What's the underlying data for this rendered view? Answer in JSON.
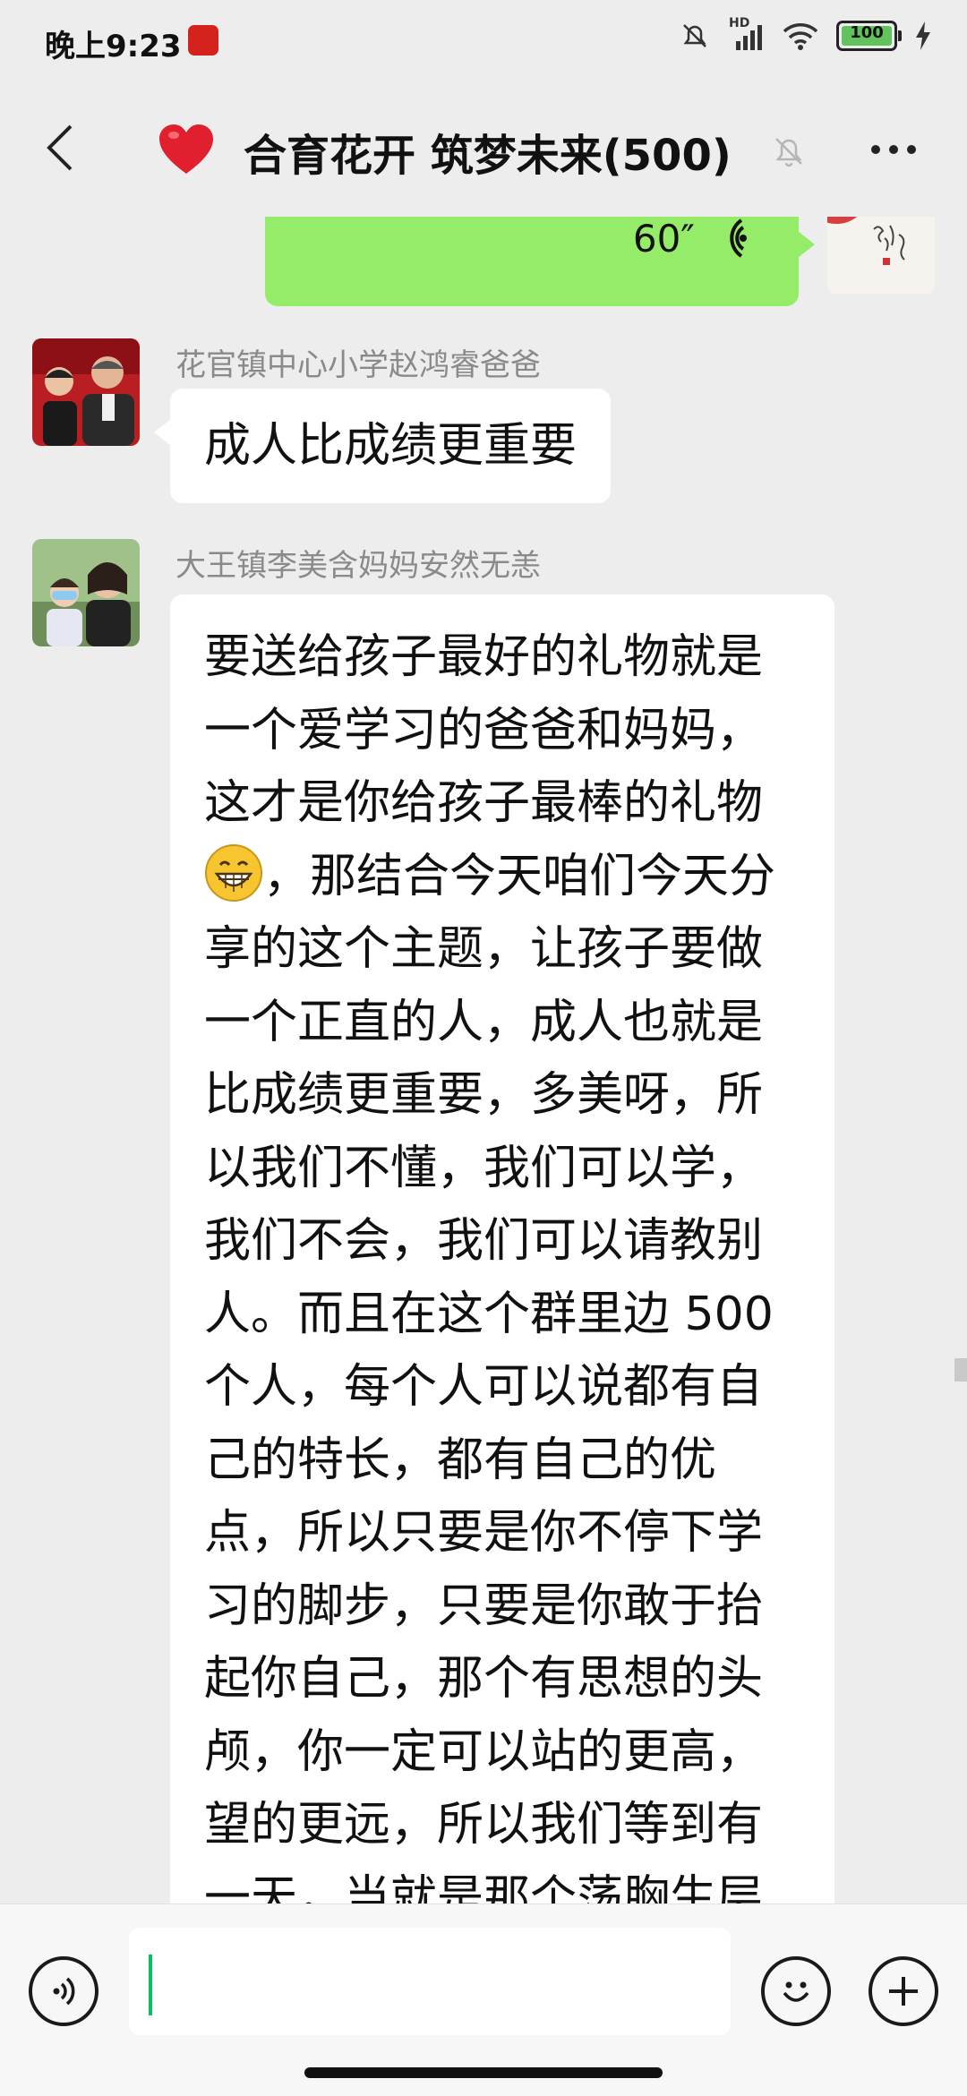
{
  "status_bar": {
    "time": "晚上9:23",
    "network": "HD",
    "battery": "100"
  },
  "header": {
    "title": "合育花开 筑梦未来(500)",
    "icons": [
      "back-icon",
      "heart-icon",
      "mute-bell-icon",
      "more-icon"
    ]
  },
  "messages": [
    {
      "type": "voice",
      "self": true,
      "duration": "60″"
    },
    {
      "type": "text",
      "sender": "花官镇中心小学赵鸿睿爸爸",
      "text": "成人比成绩更重要"
    },
    {
      "type": "text",
      "sender": "大王镇李美含妈妈安然无恙",
      "text_before_emoji": "要送给孩子最好的礼物就是一个爱学习的爸爸和妈妈，这才是你给孩子最棒的礼物",
      "emoji": "grinning-face",
      "text_after_emoji": "，那结合今天咱们今天分享的这个主题，让孩子要做一个正直的人，成人也就是比成绩更重要，多美呀，所以我们不懂，我们可以学，我们不会，我们可以请教别人。而且在这个群里边 500个人，每个人可以说都有自己的特长，都有自己的优点，所以只要是你不停下学习的脚步，只要是你敢于抬起你自己，那个有思想的头颅，你一定可以站的更高，望的更远，所以我们等到有一天，当就是那个荡胸生层云"
    }
  ],
  "input_bar": {
    "value": "",
    "icons": [
      "voice-input-icon",
      "emoji-icon",
      "plus-icon"
    ]
  },
  "colors": {
    "background": "#ededed",
    "self_bubble": "#95ec69",
    "other_bubble": "#ffffff",
    "caret": "#07c160"
  }
}
